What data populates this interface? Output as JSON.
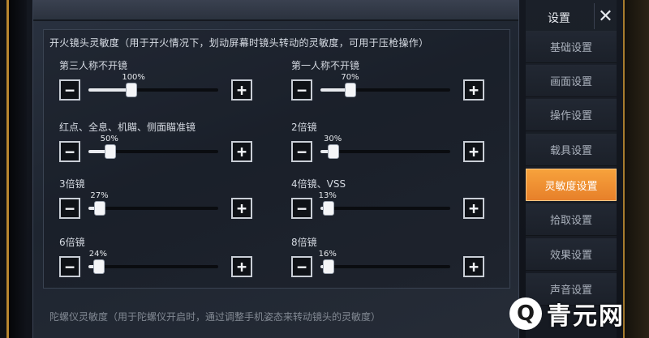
{
  "nav": {
    "title": "设置",
    "close_icon": "close-icon",
    "items": [
      {
        "label": "基础设置",
        "active": false
      },
      {
        "label": "画面设置",
        "active": false
      },
      {
        "label": "操作设置",
        "active": false
      },
      {
        "label": "载具设置",
        "active": false
      },
      {
        "label": "灵敏度设置",
        "active": true
      },
      {
        "label": "拾取设置",
        "active": false
      },
      {
        "label": "效果设置",
        "active": false
      },
      {
        "label": "声音设置",
        "active": false
      }
    ]
  },
  "section": {
    "title": "开火镜头灵敏度（用于开火情况下，划动屏幕时镜头转动的灵敏度，可用于压枪操作）",
    "sliders": [
      {
        "label": "第三人称不开镜",
        "value": 100,
        "display": "100%"
      },
      {
        "label": "第一人称不开镜",
        "value": 70,
        "display": "70%"
      },
      {
        "label": "红点、全息、机瞄、侧面瞄准镜",
        "value": 50,
        "display": "50%"
      },
      {
        "label": "2倍镜",
        "value": 30,
        "display": "30%"
      },
      {
        "label": "3倍镜",
        "value": 27,
        "display": "27%"
      },
      {
        "label": "4倍镜、VSS",
        "value": 13,
        "display": "13%"
      },
      {
        "label": "6倍镜",
        "value": 24,
        "display": "24%"
      },
      {
        "label": "8倍镜",
        "value": 16,
        "display": "16%"
      }
    ],
    "slider_max": 300,
    "minus_glyph": "−",
    "plus_glyph": "+"
  },
  "next_section_title": "陀螺仪灵敏度（用于陀螺仪开启时，通过调整手机姿态来转动镜头的灵敏度）",
  "watermark": {
    "logo_glyph": "Q",
    "text": "青元网"
  },
  "colors": {
    "accent": "#f39a35",
    "frame_gold": "#b8862f"
  }
}
